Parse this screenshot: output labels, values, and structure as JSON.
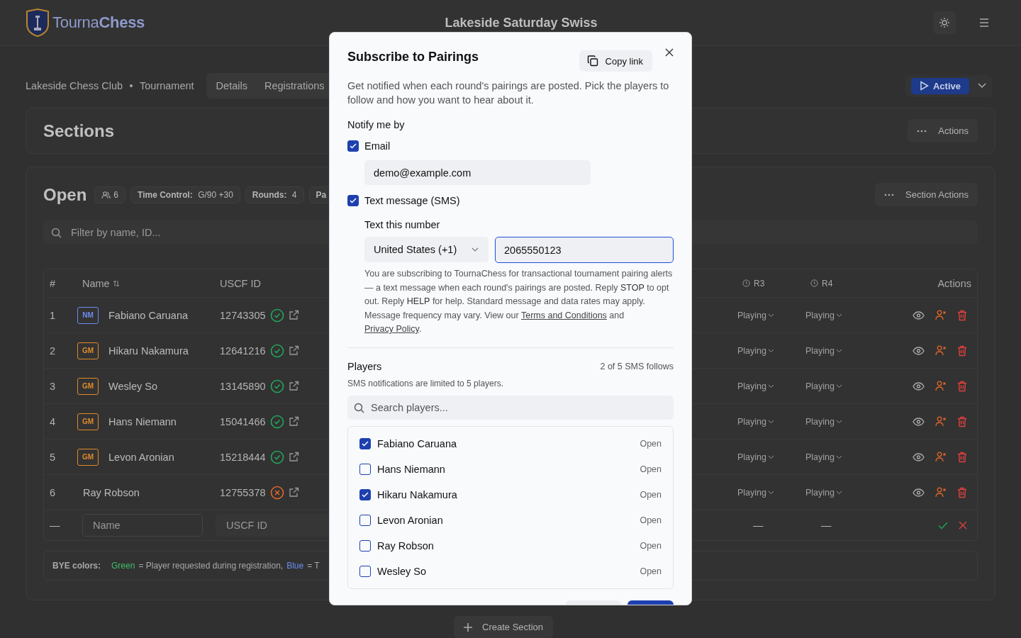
{
  "header": {
    "logo": "Tourna**Chess**",
    "title": "Lakeside Saturday Swiss"
  },
  "breadcrumb": [
    "Lakeside Chess Club",
    "Tournament"
  ],
  "tabs": [
    {
      "label": "Details",
      "selected": false
    },
    {
      "label": "Registrations",
      "selected": false
    }
  ],
  "status": {
    "label": "Active"
  },
  "sections_card": {
    "title": "Sections",
    "action": "Actions"
  },
  "section": {
    "name": "Open",
    "player_count": "6",
    "chips": [
      {
        "label": "Time Control:",
        "value": "G/90 +30"
      },
      {
        "label": "Rounds:",
        "value": "4"
      },
      {
        "label": "Pa"
      }
    ],
    "action": "Section Actions",
    "filter_placeholder": "Filter by name, ID...",
    "table": {
      "columns": {
        "number": "#",
        "name": "Name",
        "uscf": "USCF ID",
        "rounds": [
          "R3",
          "R4"
        ],
        "actions": "Actions"
      },
      "rows": [
        {
          "number": "1",
          "title": "NM",
          "color": "#6b8cf0",
          "name": "Fabiano Caruana",
          "uscf_id": "12743305",
          "verified": true,
          "rounds": [
            "Playing",
            "Playing"
          ]
        },
        {
          "number": "2",
          "title": "GM",
          "color": "#e08a2a",
          "name": "Hikaru Nakamura",
          "uscf_id": "12641216",
          "verified": true,
          "rounds": [
            "Playing",
            "Playing"
          ]
        },
        {
          "number": "3",
          "title": "GM",
          "color": "#e08a2a",
          "name": "Wesley So",
          "uscf_id": "13145890",
          "verified": true,
          "rounds": [
            "Playing",
            "Playing"
          ]
        },
        {
          "number": "4",
          "title": "GM",
          "color": "#e08a2a",
          "name": "Hans Niemann",
          "uscf_id": "15041466",
          "verified": true,
          "rounds": [
            "Playing",
            "Playing"
          ]
        },
        {
          "number": "5",
          "title": "GM",
          "color": "#e08a2a",
          "name": "Levon Aronian",
          "uscf_id": "15218444",
          "verified": true,
          "rounds": [
            "Playing",
            "Playing"
          ]
        },
        {
          "number": "6",
          "name": "Ray Robson",
          "uscf_id": "12755378",
          "verified": false,
          "rounds": [
            "Playing",
            "Playing"
          ]
        }
      ],
      "new_row": {
        "number": "—",
        "name_placeholder": "Name",
        "uscf_placeholder": "USCF ID",
        "rounds": [
          "—",
          "—"
        ]
      }
    },
    "legend": {
      "label": "BYE colors:",
      "items": [
        {
          "name": "Green",
          "color": "#3fbf6a",
          "text": "= Player requested during registration,"
        },
        {
          "name": "Blue",
          "color": "#6b8cf0",
          "text": "= T"
        }
      ]
    }
  },
  "create_button": "Create Section",
  "modal": {
    "title": "Subscribe to Pairings",
    "copy_link": "Copy link",
    "description": "Get notified when each round's pairings are posted. Pick the players to follow and how you want to hear about it.",
    "notify_label": "Notify me by",
    "email": {
      "label": "Email",
      "checked": true,
      "value": "demo@example.com"
    },
    "sms": {
      "label": "Text message (SMS)",
      "checked": true,
      "number_label": "Text this number",
      "country": "United States (+1)",
      "phone": "2065550123",
      "disclosure": {
        "text": "You are subscribing to TournaChess for transactional tournament pairing alerts — a text message when each round's pairings are posted. Reply **STOP** to opt out. Reply **HELP** for help. Standard message and data rates may apply. Message frequency may vary. View our",
        "link_1": "Terms and Conditions",
        "joiner": "and",
        "link_2": "Privacy Policy",
        "end": "."
      }
    },
    "players": {
      "title": "Players",
      "count": "2 of 5 SMS follows",
      "note": "SMS notifications are limited to 5 players.",
      "search_placeholder": "Search players...",
      "list": [
        {
          "name": "Fabiano Caruana",
          "section": "Open",
          "selected": true
        },
        {
          "name": "Hans Niemann",
          "section": "Open",
          "selected": false
        },
        {
          "name": "Hikaru Nakamura",
          "section": "Open",
          "selected": true
        },
        {
          "name": "Levon Aronian",
          "section": "Open",
          "selected": false
        },
        {
          "name": "Ray Robson",
          "section": "Open",
          "selected": false
        },
        {
          "name": "Wesley So",
          "section": "Open",
          "selected": false
        }
      ]
    }
  }
}
